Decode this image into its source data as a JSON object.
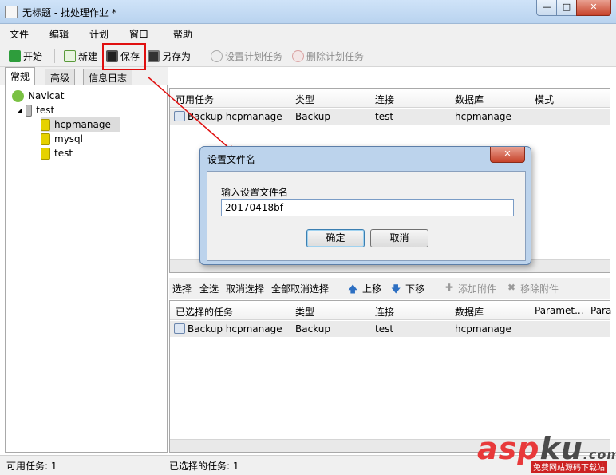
{
  "window": {
    "title": "无标题 - 批处理作业 *",
    "min": "—",
    "max": "□",
    "close": "✕"
  },
  "menu": [
    "文件",
    "编辑",
    "计划",
    "窗口",
    "帮助"
  ],
  "toolbar": {
    "start": "开始",
    "new": "新建",
    "save": "保存",
    "save_as": "另存为",
    "set_schedule": "设置计划任务",
    "delete_schedule": "删除计划任务"
  },
  "tabs": [
    "常规",
    "高级",
    "信息日志"
  ],
  "tree": {
    "root": "Navicat",
    "connection": "test",
    "databases": [
      "hcpmanage",
      "mysql",
      "test"
    ]
  },
  "top_table": {
    "columns": [
      "可用任务",
      "类型",
      "连接",
      "数据库",
      "模式"
    ],
    "rows": [
      {
        "task": "Backup hcpmanage",
        "type": "Backup",
        "conn": "test",
        "db": "hcpmanage"
      }
    ]
  },
  "midbar": {
    "select": "选择",
    "select_all": "全选",
    "deselect": "取消选择",
    "deselect_all": "全部取消选择",
    "up": "上移",
    "down": "下移",
    "add_attach": "添加附件",
    "remove_attach": "移除附件"
  },
  "bottom_table": {
    "columns": [
      "已选择的任务",
      "类型",
      "连接",
      "数据库",
      "Paramet...",
      "Para"
    ],
    "rows": [
      {
        "task": "Backup hcpmanage",
        "type": "Backup",
        "conn": "test",
        "db": "hcpmanage"
      }
    ]
  },
  "status": {
    "left": "可用任务: 1",
    "right": "已选择的任务: 1"
  },
  "dialog": {
    "title": "设置文件名",
    "label": "输入设置文件名",
    "value": "20170418bf",
    "ok": "确定",
    "cancel": "取消"
  },
  "watermark": {
    "main_a": "asp",
    "main_b": "ku",
    "tail": ".com",
    "sub": "免费网站源码下载站"
  },
  "colors": {
    "highlight": "#e01010",
    "accent": "#3c7fb1"
  }
}
